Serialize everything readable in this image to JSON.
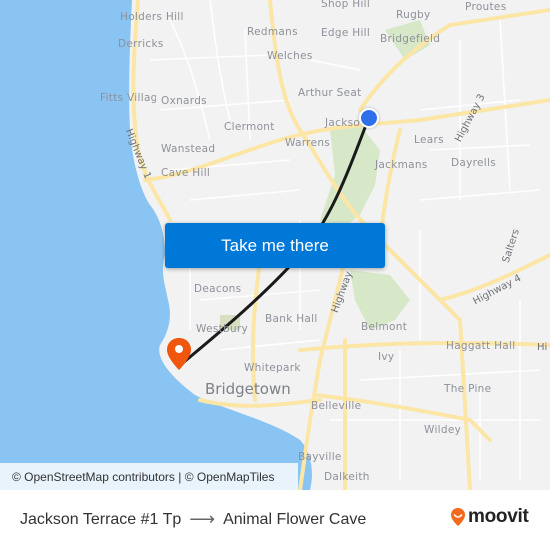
{
  "map": {
    "colors": {
      "water": "#8ac4f2",
      "land": "#f2f2f3",
      "major_road": "#fbe6a6",
      "minor_road": "#ffffff",
      "park": "#d6e8c8",
      "route_line": "#1a1a1a",
      "origin_marker": "#2e6fec",
      "destination_marker": "#f0560e",
      "button": "#0078d8"
    },
    "places": [
      {
        "id": "holders-hill",
        "label": "Holders Hill"
      },
      {
        "id": "derricks",
        "label": "Derricks"
      },
      {
        "id": "fitts-village",
        "label": "Fitts Villag"
      },
      {
        "id": "oxnards",
        "label": "Oxnards"
      },
      {
        "id": "clermont",
        "label": "Clermont"
      },
      {
        "id": "wanstead",
        "label": "Wanstead"
      },
      {
        "id": "cave-hill",
        "label": "Cave Hill"
      },
      {
        "id": "redmans",
        "label": "Redmans"
      },
      {
        "id": "welches",
        "label": "Welches"
      },
      {
        "id": "shop-hill",
        "label": "Shop Hill"
      },
      {
        "id": "edge-hill",
        "label": "Edge Hill"
      },
      {
        "id": "rugby",
        "label": "Rugby"
      },
      {
        "id": "bridgefield",
        "label": "Bridgefield"
      },
      {
        "id": "proutes",
        "label": "Proutes"
      },
      {
        "id": "arthur-seat",
        "label": "Arthur Seat"
      },
      {
        "id": "jackson",
        "label": "Jackso"
      },
      {
        "id": "warrens",
        "label": "Warrens"
      },
      {
        "id": "lears",
        "label": "Lears"
      },
      {
        "id": "jackmans",
        "label": "Jackmans"
      },
      {
        "id": "dayrells",
        "label": "Dayrells"
      },
      {
        "id": "salters",
        "label": "Salters"
      },
      {
        "id": "deacons",
        "label": "Deacons"
      },
      {
        "id": "bank-hall",
        "label": "Bank Hall"
      },
      {
        "id": "westbury",
        "label": "Westbury"
      },
      {
        "id": "belmont",
        "label": "Belmont"
      },
      {
        "id": "haggatt-hall",
        "label": "Haggatt Hall"
      },
      {
        "id": "ivy",
        "label": "Ivy"
      },
      {
        "id": "whitepark",
        "label": "Whitepark"
      },
      {
        "id": "bridgetown",
        "label": "Bridgetown"
      },
      {
        "id": "the-pine",
        "label": "The Pine"
      },
      {
        "id": "belleville",
        "label": "Belleville"
      },
      {
        "id": "wildey",
        "label": "Wildey"
      },
      {
        "id": "bayville",
        "label": "Bayville"
      },
      {
        "id": "dalkeith",
        "label": "Dalkeith"
      }
    ],
    "roads": [
      {
        "id": "highway-1",
        "label": "Highway 1"
      },
      {
        "id": "highway-3",
        "label": "Highway 3"
      },
      {
        "id": "highway-4",
        "label": "Highway 4"
      },
      {
        "id": "highway-2a",
        "label": "Highway"
      },
      {
        "id": "highway-edge",
        "label": "Hi"
      }
    ],
    "cta_label": "Take me there",
    "attribution": {
      "osm": "© OpenStreetMap contributors",
      "separator": " | ",
      "omt": "© OpenMapTiles"
    }
  },
  "footer": {
    "origin": "Jackson Terrace #1 Tp",
    "arrow": "⟶",
    "destination": "Animal Flower Cave",
    "brand": "moovit"
  }
}
